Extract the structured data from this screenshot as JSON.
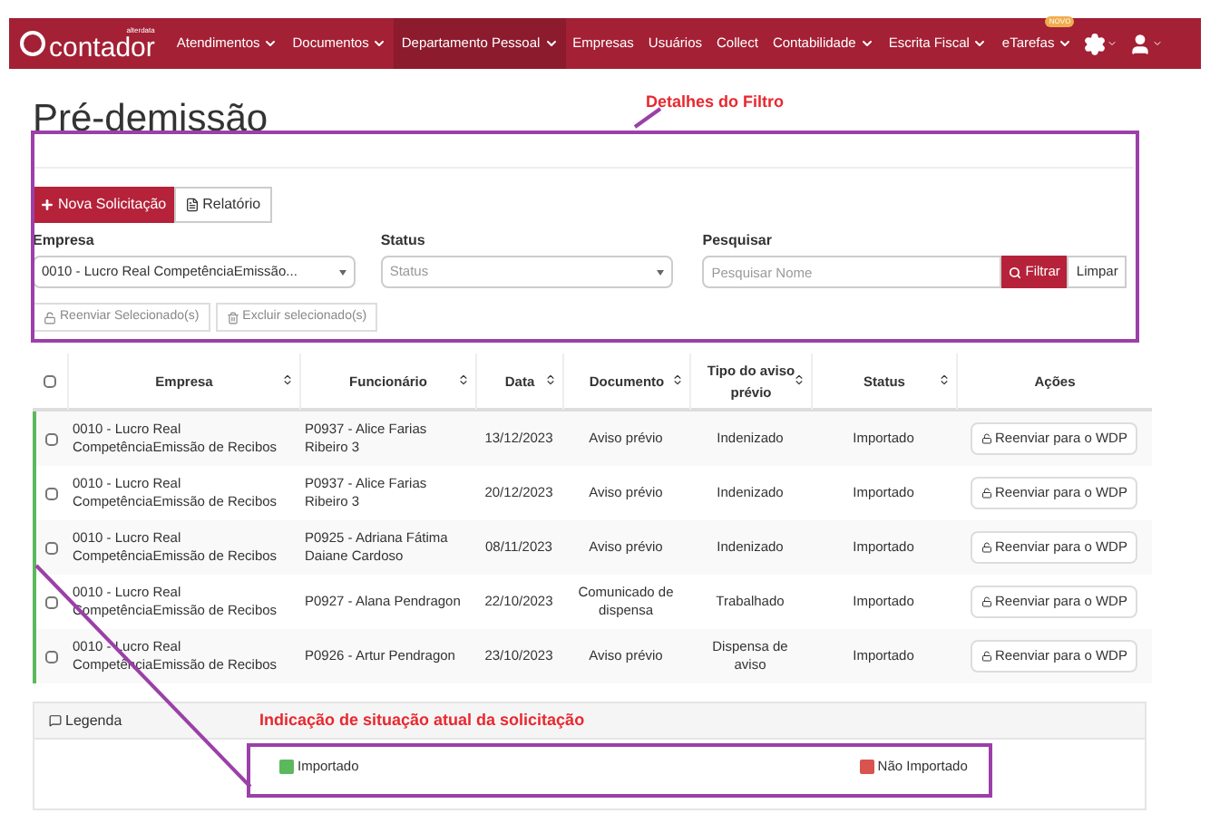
{
  "navbar": {
    "logo_small": "alterdata",
    "logo": "contador",
    "items": [
      {
        "label": "Atendimentos",
        "dropdown": true,
        "selected": false
      },
      {
        "label": "Documentos",
        "dropdown": true,
        "selected": false
      },
      {
        "label": "Departamento Pessoal",
        "dropdown": true,
        "selected": true
      },
      {
        "label": "Empresas",
        "dropdown": false,
        "selected": false
      },
      {
        "label": "Usuários",
        "dropdown": false,
        "selected": false
      },
      {
        "label": "Collect",
        "dropdown": false,
        "selected": false
      },
      {
        "label": "Contabilidade",
        "dropdown": true,
        "selected": false
      },
      {
        "label": "Escrita Fiscal",
        "dropdown": true,
        "selected": false
      },
      {
        "label": "eTarefas",
        "dropdown": true,
        "selected": false,
        "badge": "NOVO"
      }
    ]
  },
  "page_title": "Pré-demissão",
  "annotations": [
    {
      "text": "Detalhes do Filtro"
    },
    {
      "text": "Indicação de situação atual da solicitação"
    }
  ],
  "toolbar": {
    "primary": "Nova Solicitação",
    "secondary": "Relatório"
  },
  "filters": {
    "empresa": {
      "label": "Empresa",
      "value": "0010 - Lucro Real CompetênciaEmissão..."
    },
    "status": {
      "label": "Status",
      "placeholder": "Status"
    },
    "search": {
      "label": "Pesquisar",
      "placeholder": "Pesquisar Nome",
      "button": "Filtrar",
      "clear": "Limpar"
    }
  },
  "bulk_actions": [
    "Reenviar Selecionado(s)",
    "Excluir selecionado(s)"
  ],
  "table": {
    "select_all_checked": false,
    "columns": [
      "Empresa",
      "Funcionário",
      "Data",
      "Documento",
      "Tipo do aviso prévio",
      "Status",
      "Ações"
    ],
    "rows": [
      {
        "empresa": "0010 - Lucro Real CompetênciaEmissão de Recibos",
        "funcionario": "P0937 - Alice Farias Ribeiro 3",
        "data": "13/12/2023",
        "documento": "Aviso prévio",
        "tipo": "Indenizado",
        "status": "Importado",
        "action": "Reenviar para o WDP",
        "color": "#5cb85c",
        "checked": false
      },
      {
        "empresa": "0010 - Lucro Real CompetênciaEmissão de Recibos",
        "funcionario": "P0937 - Alice Farias Ribeiro 3",
        "data": "20/12/2023",
        "documento": "Aviso prévio",
        "tipo": "Indenizado",
        "status": "Importado",
        "action": "Reenviar para o WDP",
        "color": "#5cb85c",
        "checked": false
      },
      {
        "empresa": "0010 - Lucro Real CompetênciaEmissão de Recibos",
        "funcionario": "P0925 - Adriana Fátima Daiane Cardoso",
        "data": "08/11/2023",
        "documento": "Aviso prévio",
        "tipo": "Indenizado",
        "status": "Importado",
        "action": "Reenviar para o WDP",
        "color": "#5cb85c",
        "checked": false
      },
      {
        "empresa": "0010 - Lucro Real CompetênciaEmissão de Recibos",
        "funcionario": "P0927 - Alana Pendragon",
        "data": "22/10/2023",
        "documento": "Comunicado de dispensa",
        "tipo": "Trabalhado",
        "status": "Importado",
        "action": "Reenviar para o WDP",
        "color": "#5cb85c",
        "checked": false
      },
      {
        "empresa": "0010 - Lucro Real CompetênciaEmissão de Recibos",
        "funcionario": "P0926 - Artur Pendragon",
        "data": "23/10/2023",
        "documento": "Aviso prévio",
        "tipo": "Dispensa de aviso",
        "status": "Importado",
        "action": "Reenviar para o WDP",
        "color": "#5cb85c",
        "checked": false
      }
    ]
  },
  "legend": {
    "title": "Legenda",
    "items": [
      {
        "label": "Importado",
        "color": "#5cb85c"
      },
      {
        "label": "Não Importado",
        "color": "#d9534f"
      }
    ]
  }
}
